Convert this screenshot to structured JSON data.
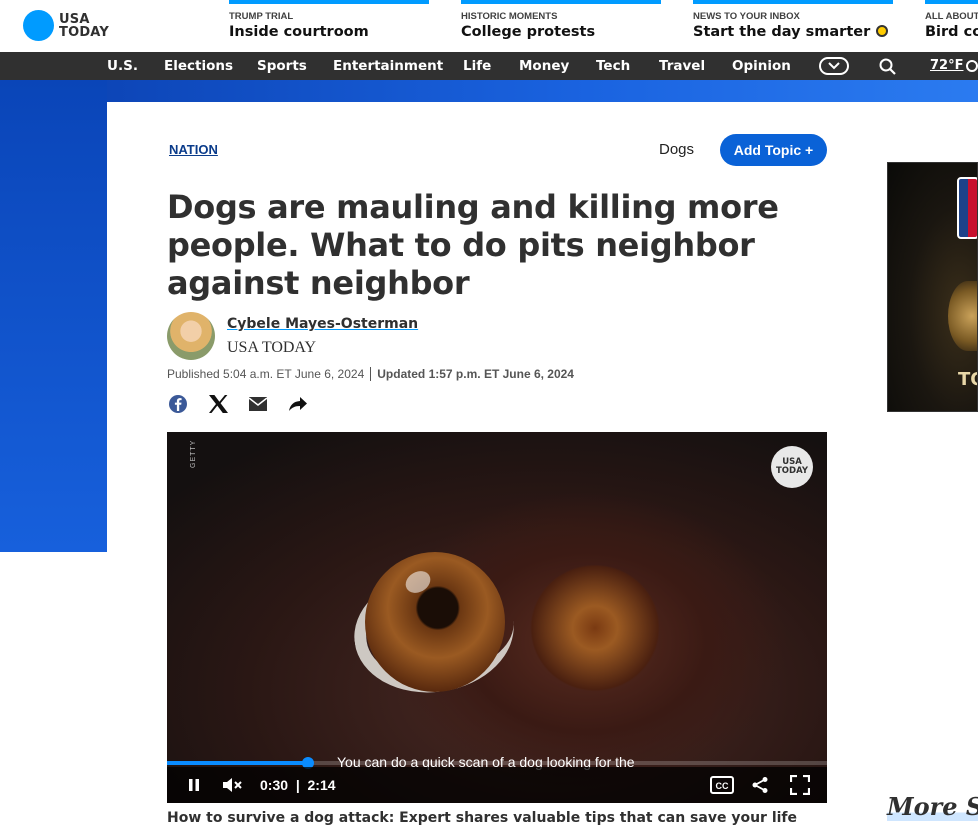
{
  "header": {
    "logo": {
      "line1": "USA",
      "line2": "TODAY"
    },
    "promos": [
      {
        "kicker": "TRUMP TRIAL",
        "headline": "Inside courtroom"
      },
      {
        "kicker": "HISTORIC MOMENTS",
        "headline": "College protests"
      },
      {
        "kicker": "NEWS TO YOUR INBOX",
        "headline": "Start the day smarter"
      },
      {
        "kicker": "ALL ABOUT",
        "headline": "Bird co"
      }
    ]
  },
  "nav": {
    "items": [
      "U.S.",
      "Elections",
      "Sports",
      "Entertainment",
      "Life",
      "Money",
      "Tech",
      "Travel",
      "Opinion"
    ],
    "temperature": "72°F"
  },
  "article": {
    "section": "NATION",
    "topic": "Dogs",
    "add_topic_label": "Add Topic +",
    "headline": "Dogs are mauling and killing more people. What to do pits neighbor against neighbor",
    "author": "Cybele Mayes-Osterman",
    "outlet": "USA TODAY",
    "published": "Published 5:04 a.m. ET June 6, 2024",
    "updated": "Updated 1:57 p.m. ET June 6, 2024"
  },
  "video": {
    "watermark": "GETTY",
    "logo": {
      "line1": "USA",
      "line2": "TODAY"
    },
    "caption": "You can do a quick scan of a dog looking for the",
    "current_time": "0:30",
    "time_separator": "|",
    "duration": "2:14",
    "progress": 0.214,
    "title": "How to survive a dog attack: Expert shares valuable tips that can save your life"
  },
  "sidebar": {
    "ad_text": "TO",
    "more_stories": "More St"
  },
  "colors": {
    "brand_blue": "#009bff",
    "nav_bg": "#303030",
    "button_blue": "#0a62d7",
    "progress_blue": "#0a8cff"
  }
}
